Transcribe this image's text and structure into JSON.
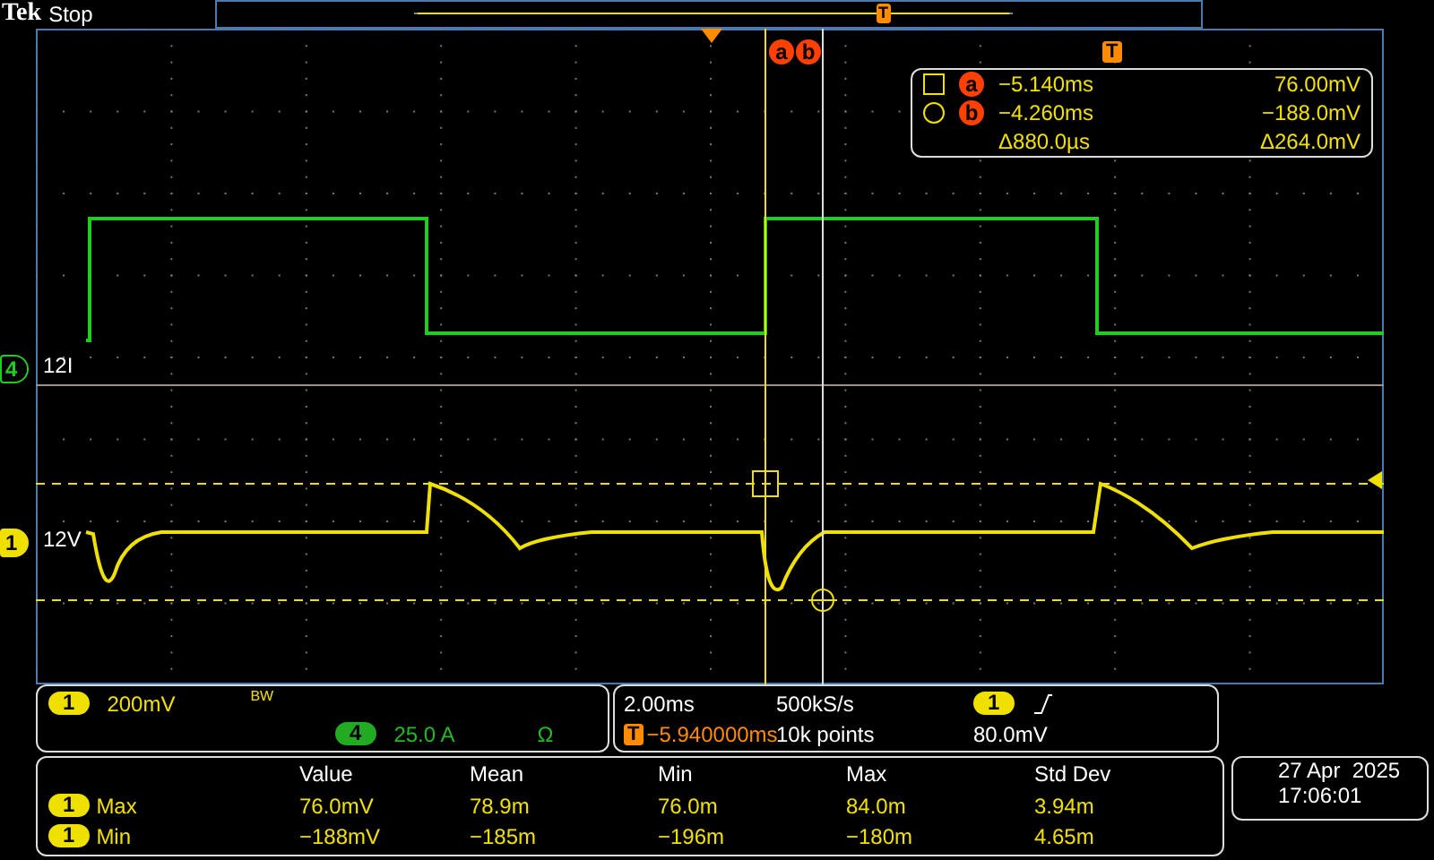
{
  "header": {
    "brand": "Tek",
    "run_state": "Stop",
    "overview_trigger": "T"
  },
  "cursor_tags": [
    "a",
    "b"
  ],
  "channels": [
    {
      "number": "4",
      "label": "12I",
      "color": "#22cc22"
    },
    {
      "number": "1",
      "label": "12V",
      "color": "#f0e000"
    }
  ],
  "cursor_readout": {
    "trigger": "T",
    "rows": [
      {
        "kind": "square",
        "cursor": "a",
        "time": "−5.140ms",
        "value": "76.00mV"
      },
      {
        "kind": "circle",
        "cursor": "b",
        "time": "−4.260ms",
        "value": "−188.0mV"
      }
    ],
    "delta_time": "Δ880.0µs",
    "delta_value": "Δ264.0mV"
  },
  "vertical": {
    "channel": "1",
    "scale": "200mV",
    "bandwidth": "BW",
    "channel_2": "4",
    "scale_2": "25.0 A",
    "unit_2": "Ω"
  },
  "horizontal": {
    "scale": "2.00ms",
    "rate": "500kS/s",
    "trigger": "T",
    "position": "−5.940000ms",
    "record": "10k points"
  },
  "trigger": {
    "channel": "1",
    "level": "80.0mV"
  },
  "measurements": {
    "columns": [
      "Value",
      "Mean",
      "Min",
      "Max",
      "Std Dev"
    ],
    "rows": [
      {
        "channel": "1",
        "name": "Max",
        "cells": [
          "76.0mV",
          "78.9m",
          "76.0m",
          "84.0m",
          "3.94m"
        ]
      },
      {
        "channel": "1",
        "name": "Min",
        "cells": [
          "−188mV",
          "−185m",
          "−196m",
          "−180m",
          "4.65m"
        ]
      }
    ]
  },
  "datetime": {
    "date": "27 Apr  2025",
    "time": "17:06:01"
  }
}
